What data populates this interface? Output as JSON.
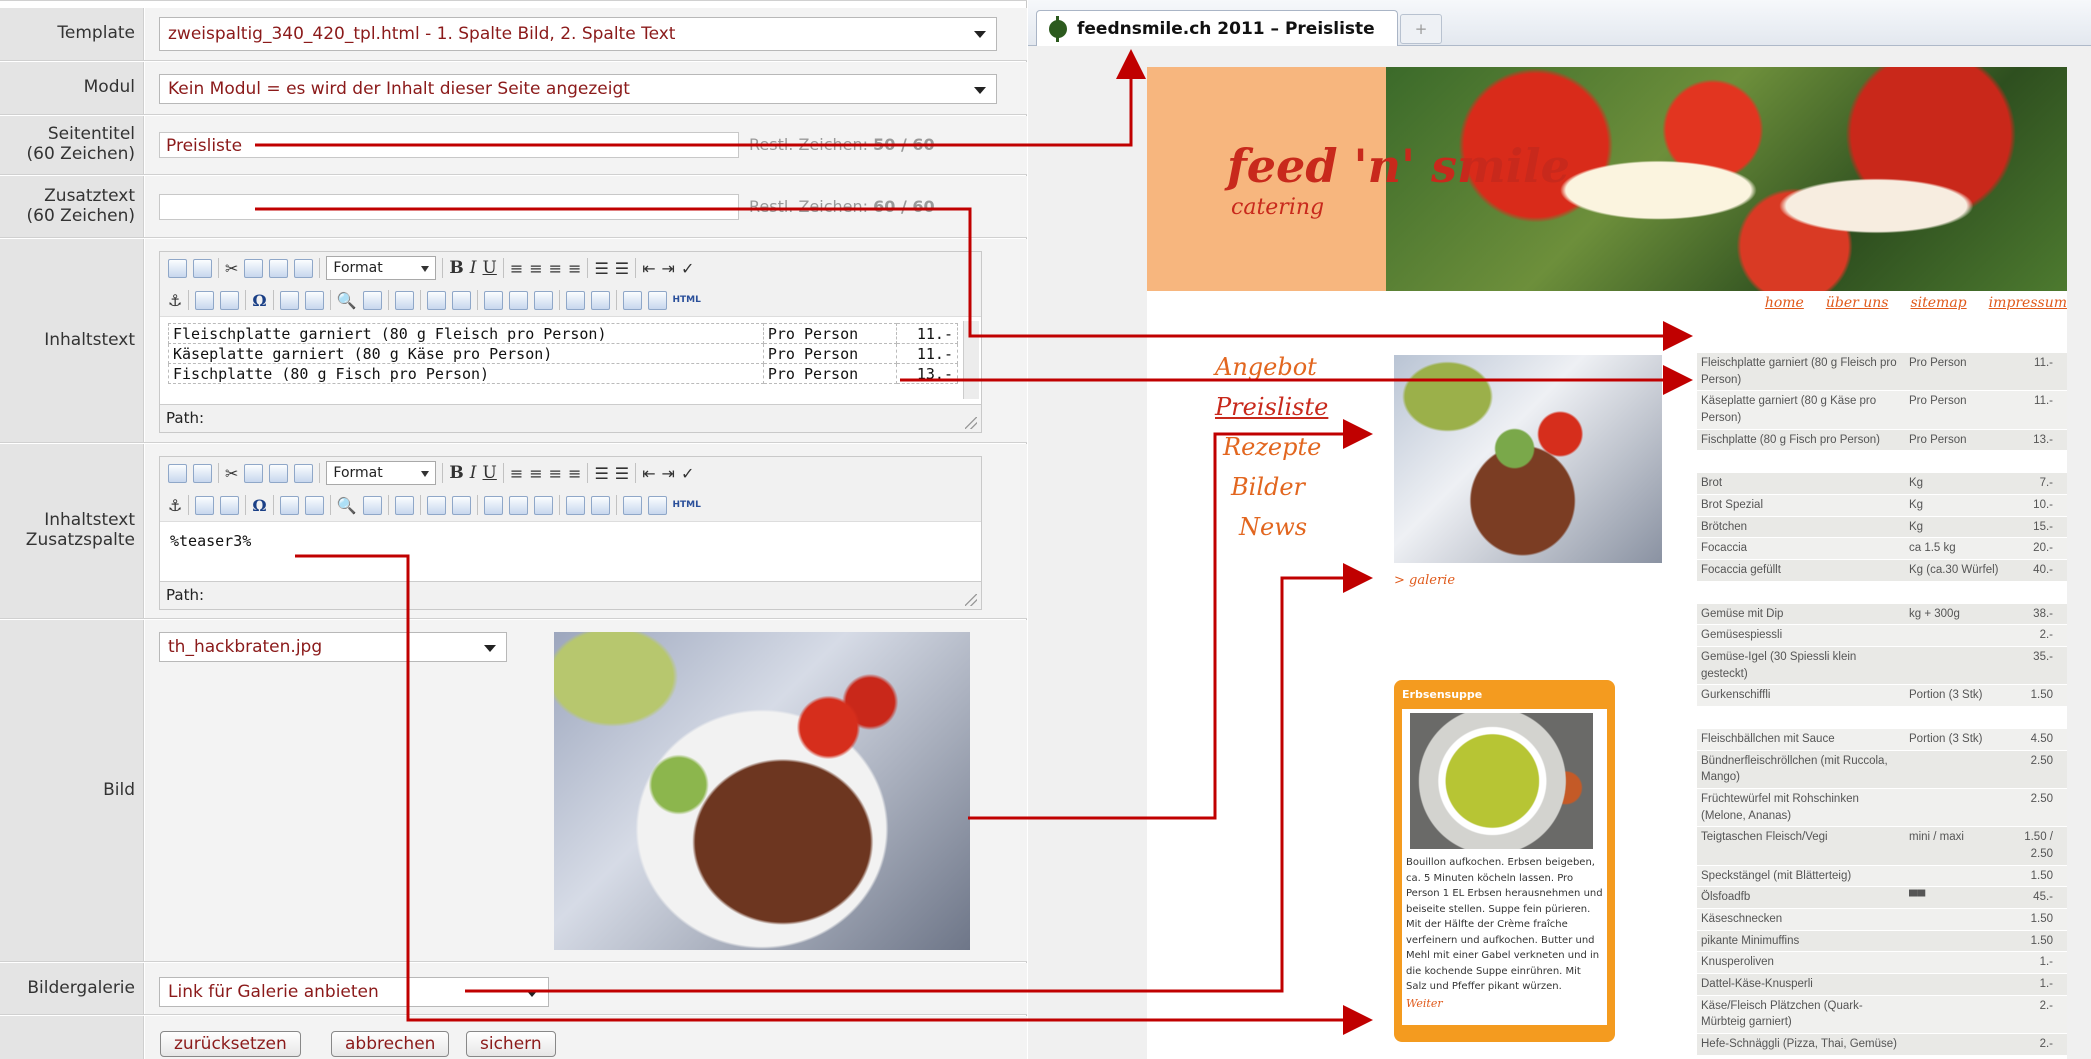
{
  "form": {
    "template": {
      "label": "Template",
      "value": "zweispaltig_340_420_tpl.html - 1. Spalte Bild, 2. Spalte Text"
    },
    "modul": {
      "label": "Modul",
      "value": "Kein Modul = es wird der Inhalt dieser Seite angezeigt"
    },
    "seitentitel": {
      "label1": "Seitentitel",
      "label2": "(60 Zeichen)",
      "value": "Preisliste",
      "rest_label": "Restl. Zeichen:",
      "rest_value": "50 / 60"
    },
    "zusatztext": {
      "label1": "Zusatztext",
      "label2": "(60 Zeichen)",
      "value": "",
      "rest_label": "Restl. Zeichen:",
      "rest_value": "60 / 60"
    },
    "inhaltstext": {
      "label": "Inhaltstext",
      "format_label": "Format",
      "path_label": "Path:",
      "rows": [
        {
          "item": "Fleischplatte garniert (80 g Fleisch pro Person)",
          "unit": "Pro Person",
          "price": "11.-"
        },
        {
          "item": "Käseplatte garniert (80 g Käse pro Person)",
          "unit": "Pro Person",
          "price": "11.-"
        },
        {
          "item": "Fischplatte (80 g Fisch pro Person)",
          "unit": "Pro Person",
          "price": "13.-"
        }
      ]
    },
    "zusatzspalte": {
      "label1": "Inhaltstext",
      "label2": "Zusatzspalte",
      "format_label": "Format",
      "path_label": "Path:",
      "content": "%teaser3%"
    },
    "bild": {
      "label": "Bild",
      "file": "th_hackbraten.jpg"
    },
    "bildergalerie": {
      "label": "Bildergalerie",
      "value": "Link für Galerie anbieten"
    },
    "buttons": {
      "reset": "zurücksetzen",
      "cancel": "abbrechen",
      "save": "sichern"
    }
  },
  "browser": {
    "tab_title": "feednsmile.ch 2011 – Preisliste",
    "new_tab": "+",
    "site": {
      "logo": "feed 'n' smile",
      "logo_sub": "catering",
      "topnav": [
        "home",
        "über uns",
        "sitemap",
        "impressum"
      ],
      "sidenav": [
        "Angebot",
        "Preisliste",
        "Rezepte",
        "Bilder",
        "News"
      ],
      "galerie_link": "> galerie",
      "teaser": {
        "title": "Erbsensuppe",
        "text": "Bouillon aufkochen. Erbsen beigeben, ca. 5 Minuten köcheln lassen. Pro Person 1 EL Erbsen herausnehmen und beiseite stellen. Suppe fein pürieren. Mit der Hälfte der Crème fraîche verfeinern und aufkochen. Butter und Mehl mit einer Gabel verkneten und in die kochende Suppe einrühren. Mit Salz und Pfeffer pikant würzen.",
        "more": "Weiter"
      },
      "prices": [
        [
          "Fleischplatte garniert (80 g Fleisch pro Person)",
          "Pro Person",
          "11.-"
        ],
        [
          "Käseplatte garniert (80 g Käse pro Person)",
          "Pro Person",
          "11.-"
        ],
        [
          "Fischplatte (80 g Fisch pro Person)",
          "Pro Person",
          "13.-"
        ],
        [
          "",
          "",
          ""
        ],
        [
          "Brot",
          "Kg",
          "7.-"
        ],
        [
          "Brot Spezial",
          "Kg",
          "10.-"
        ],
        [
          "Brötchen",
          "Kg",
          "15.-"
        ],
        [
          "Focaccia",
          "ca 1.5 kg",
          "20.-"
        ],
        [
          "Focaccia gefüllt",
          "Kg (ca.30 Würfel)",
          "40.-"
        ],
        [
          "",
          "",
          ""
        ],
        [
          "Gemüse mit Dip",
          "kg + 300g",
          "38.-"
        ],
        [
          "Gemüsespiessli",
          "",
          "2.-"
        ],
        [
          "Gemüse-Igel (30 Spiessli klein gesteckt)",
          "",
          "35.-"
        ],
        [
          "Gurkenschiffli",
          "Portion (3 Stk)",
          "1.50"
        ],
        [
          "",
          "",
          ""
        ],
        [
          "Fleischbällchen mit Sauce",
          "Portion (3 Stk)",
          "4.50"
        ],
        [
          "Bündnerfleischröllchen (mit Ruccola, Mango)",
          "",
          "2.50"
        ],
        [
          "Früchtewürfel mit Rohschinken (Melone, Ananas)",
          "",
          "2.50"
        ],
        [
          "Teigtaschen Fleisch/Vegi",
          "mini / maxi",
          "1.50 / 2.50"
        ],
        [
          "Speckstängel (mit Blätterteig)",
          "",
          "1.50"
        ],
        [
          "Ölsfoadfb",
          "▀▀",
          "45.-"
        ],
        [
          "Käseschnecken",
          "",
          "1.50"
        ],
        [
          "pikante Minimuffins",
          "",
          "1.50"
        ],
        [
          "Knusperoliven",
          "",
          "1.-"
        ],
        [
          "Dattel-Käse-Knusperli",
          "",
          "1.-"
        ],
        [
          "Käse/Fleisch Plätzchen (Quark-Mürbteig garniert)",
          "",
          "2.-"
        ],
        [
          "Hefe-Schnäggli (Pizza, Thai, Gemüse)",
          "",
          "2.-"
        ]
      ]
    }
  },
  "colors": {
    "accent_red": "#c00000",
    "label_text": "#333333",
    "value_text": "#8b1a1a",
    "nav_orange": "#e2661f",
    "teaser_orange": "#f49b1f"
  }
}
